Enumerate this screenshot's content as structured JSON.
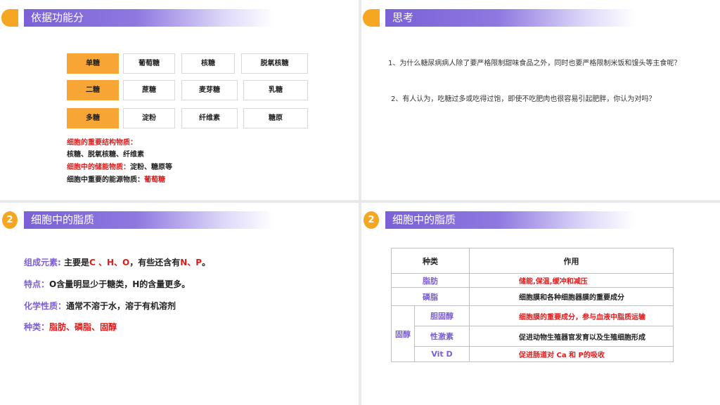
{
  "slide1": {
    "title": "依据功能分",
    "rows": [
      [
        "单糖",
        "葡萄糖",
        "核糖",
        "脱氧核糖"
      ],
      [
        "二糖",
        "蔗糖",
        "麦芽糖",
        "乳糖"
      ],
      [
        "多糖",
        "淀粉",
        "纤维素",
        "糖原"
      ]
    ],
    "notes": {
      "line1": "细胞的重要结构物质：",
      "line2": "核糖、脱氧核糖、纤维素",
      "line3_label": "细胞中的储能物质：",
      "line3_value": "淀粉、糖原等",
      "line4_label": "细胞中重要的能源物质：",
      "line4_value": "葡萄糖"
    }
  },
  "slide2": {
    "title": "思考",
    "q1": "1、为什么糖尿病病人除了要严格限制甜味食品之外，同时也要严格限制米饭和馒头等主食呢？",
    "q2": "2、有人认为，吃糖过多或吃得过饱，即使不吃肥肉也很容易引起肥胖，你认为对吗？"
  },
  "slide3": {
    "number": "2",
    "title": "细胞中的脂质",
    "line1": {
      "label": "组成元素:",
      "a": "主要是",
      "b": "C 、H、O",
      "c": "，有些还含有",
      "d": "N、P",
      "e": "。"
    },
    "line2": {
      "label": "特点：",
      "text": "O含量明显少于糖类，H的含量更多。"
    },
    "line3": {
      "label": "化学性质：",
      "text": "通常不溶于水，溶于有机溶剂"
    },
    "line4": {
      "label": "种类：",
      "text": "脂肪、磷脂、固醇"
    }
  },
  "slide4": {
    "number": "2",
    "title": "细胞中的脂质",
    "header": {
      "type": "种类",
      "function": "作用"
    },
    "fat": {
      "name": "脂肪",
      "role": "储能,保温,缓冲和减压"
    },
    "phospholipid": {
      "name": "磷脂",
      "role": "细胞膜和各种细胞器膜的重要成分"
    },
    "sterol": {
      "name": "固醇",
      "items": [
        {
          "name": "胆固醇",
          "role": "细胞膜的重要成分，参与血液中脂质运输"
        },
        {
          "name": "性激素",
          "role": "促进动物生殖器官发育以及生殖细胞形成"
        },
        {
          "name": "Vit  D",
          "role": "促进肠道对 Ca 和 P的吸收"
        }
      ]
    }
  }
}
